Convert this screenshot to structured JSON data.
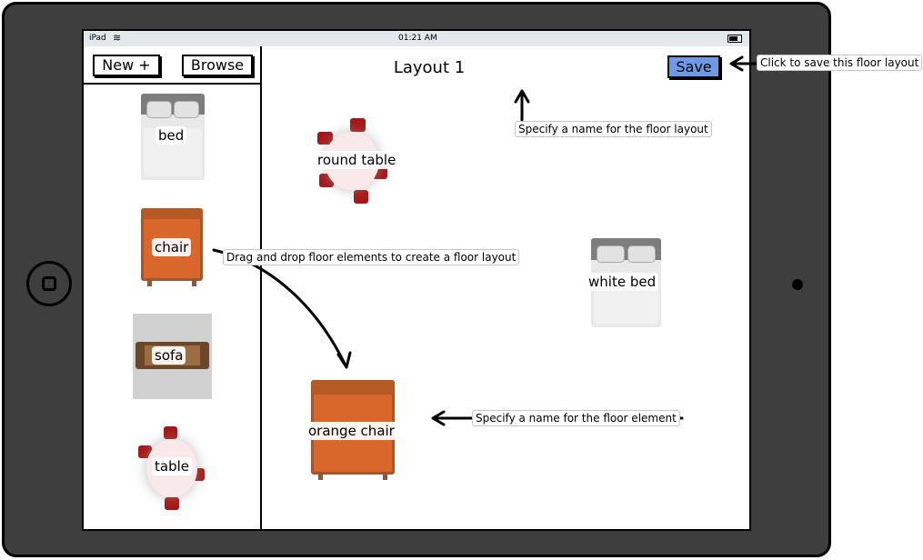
{
  "status_bar": {
    "carrier": "iPad",
    "time": "01:21 AM",
    "wifi_icon": "wifi-icon",
    "battery_icon": "battery-icon"
  },
  "sidebar": {
    "new_label": "New +",
    "browse_label": "Browse",
    "items": [
      {
        "label": "bed",
        "icon": "bed-icon"
      },
      {
        "label": "chair",
        "icon": "chair-icon"
      },
      {
        "label": "sofa",
        "icon": "sofa-icon"
      },
      {
        "label": "table",
        "icon": "round-table-icon"
      }
    ]
  },
  "canvas": {
    "layout_name": "Layout 1",
    "save_label": "Save",
    "placed_items": [
      {
        "label": "round table",
        "icon": "round-table-icon"
      },
      {
        "label": "white bed",
        "icon": "bed-icon"
      },
      {
        "label": "orange chair",
        "icon": "chair-icon"
      }
    ]
  },
  "annotations": {
    "save": "Click to save this floor layout",
    "layout_name": "Specify a name for the floor layout",
    "drag_drop": "Drag and drop floor elements to create a floor layout",
    "element_name": "Specify a name for the floor element"
  },
  "colors": {
    "device": "#3e3e3e",
    "save_button": "#6c9ae3",
    "chair_orange": "#d9662b",
    "table_seat": "#a81616",
    "status_bar": "#e3e8ea"
  }
}
